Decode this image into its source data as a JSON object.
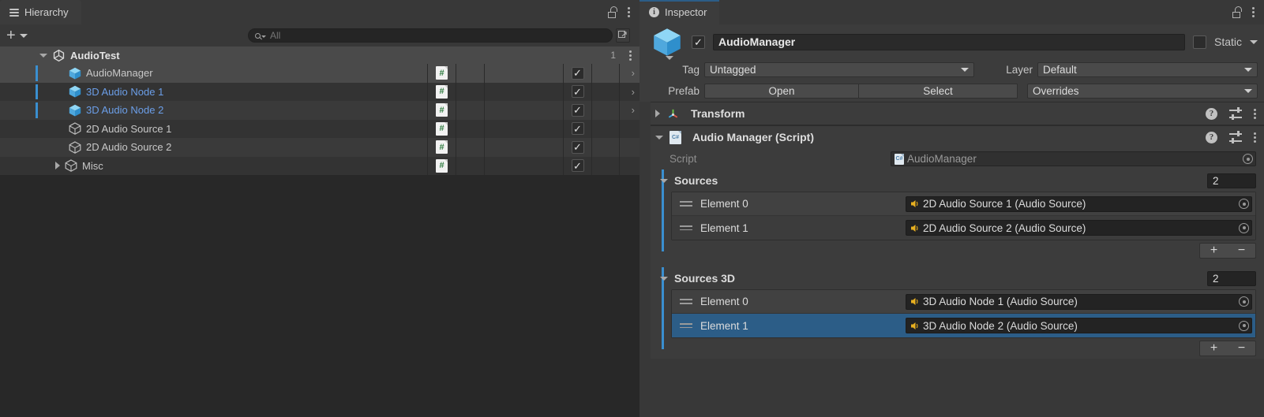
{
  "hierarchy": {
    "tab_label": "Hierarchy",
    "tab_icon": "list-icon",
    "lock_icon": "lock-open-icon",
    "menu_icon": "kebab-menu-icon",
    "toolbar": {
      "add_label": "+",
      "add_icon": "plus-icon",
      "add_dropdown_icon": "chevron-down-icon"
    },
    "search": {
      "placeholder": "All",
      "value": "",
      "icon": "search-icon",
      "side_button_icon": "search-expand-icon"
    },
    "scene": {
      "name": "AudioTest",
      "icon": "unity-scene-icon",
      "count": "1",
      "expanded": true
    },
    "items": [
      {
        "name": "AudioManager",
        "icon": "prefab-cube-icon",
        "prefab": true,
        "selected": true,
        "has_children": false,
        "script_icon": "csharp-script-icon",
        "active": true,
        "chevron": "chevron-right-icon"
      },
      {
        "name": "3D Audio Node 1",
        "icon": "prefab-cube-icon",
        "prefab": true,
        "selected": false,
        "has_children": false,
        "script_icon": "csharp-script-icon",
        "active": true,
        "chevron": "chevron-right-icon"
      },
      {
        "name": "3D Audio Node 2",
        "icon": "prefab-cube-icon",
        "prefab": true,
        "selected": false,
        "has_children": false,
        "script_icon": "csharp-script-icon",
        "active": true,
        "chevron": "chevron-right-icon"
      },
      {
        "name": "2D Audio Source 1",
        "icon": "gameobject-cube-icon",
        "prefab": false,
        "selected": false,
        "has_children": false,
        "script_icon": "csharp-script-icon",
        "active": true,
        "chevron": ""
      },
      {
        "name": "2D Audio Source 2",
        "icon": "gameobject-cube-icon",
        "prefab": false,
        "selected": false,
        "has_children": false,
        "script_icon": "csharp-script-icon",
        "active": true,
        "chevron": ""
      },
      {
        "name": "Misc",
        "icon": "gameobject-cube-icon",
        "prefab": false,
        "selected": false,
        "has_children": true,
        "script_icon": "csharp-script-icon",
        "active": true,
        "chevron": ""
      }
    ]
  },
  "inspector": {
    "tab_label": "Inspector",
    "tab_icon": "info-icon",
    "lock_icon": "lock-open-icon",
    "menu_icon": "kebab-menu-icon",
    "object": {
      "name": "AudioManager",
      "enabled": true,
      "icon": "prefab-cube-icon",
      "static_label": "Static",
      "static_checked": false
    },
    "tag": {
      "label": "Tag",
      "value": "Untagged"
    },
    "layer": {
      "label": "Layer",
      "value": "Default"
    },
    "prefab": {
      "label": "Prefab",
      "open_label": "Open",
      "select_label": "Select",
      "overrides_label": "Overrides"
    },
    "components": [
      {
        "title": "Transform",
        "icon": "transform-axis-icon",
        "expanded": false
      },
      {
        "title": "Audio Manager (Script)",
        "icon": "csharp-script-icon",
        "expanded": true
      }
    ],
    "script_field": {
      "label": "Script",
      "value": "AudioManager",
      "icon": "csharp-script-icon",
      "readonly": true
    },
    "arrays": [
      {
        "title": "Sources",
        "count": "2",
        "expanded": true,
        "elements": [
          {
            "label": "Element 0",
            "value": "2D Audio Source 1 (Audio Source)",
            "icon": "audio-source-icon",
            "selected": false
          },
          {
            "label": "Element 1",
            "value": "2D Audio Source 2 (Audio Source)",
            "icon": "audio-source-icon",
            "selected": false
          }
        ],
        "add_label": "+",
        "remove_label": "−"
      },
      {
        "title": "Sources 3D",
        "count": "2",
        "expanded": true,
        "elements": [
          {
            "label": "Element 0",
            "value": "3D Audio Node 1 (Audio Source)",
            "icon": "audio-source-icon",
            "selected": false
          },
          {
            "label": "Element 1",
            "value": "3D Audio Node 2 (Audio Source)",
            "icon": "audio-source-icon",
            "selected": true
          }
        ],
        "add_label": "+",
        "remove_label": "−"
      }
    ]
  },
  "colors": {
    "accent_blue": "#3a8fd0",
    "selection_blue": "#2c5d87",
    "prefab_text": "#6b9ee8",
    "panel_bg": "#383838",
    "tree_bg": "#282828",
    "audio_yellow": "#e8b020"
  }
}
